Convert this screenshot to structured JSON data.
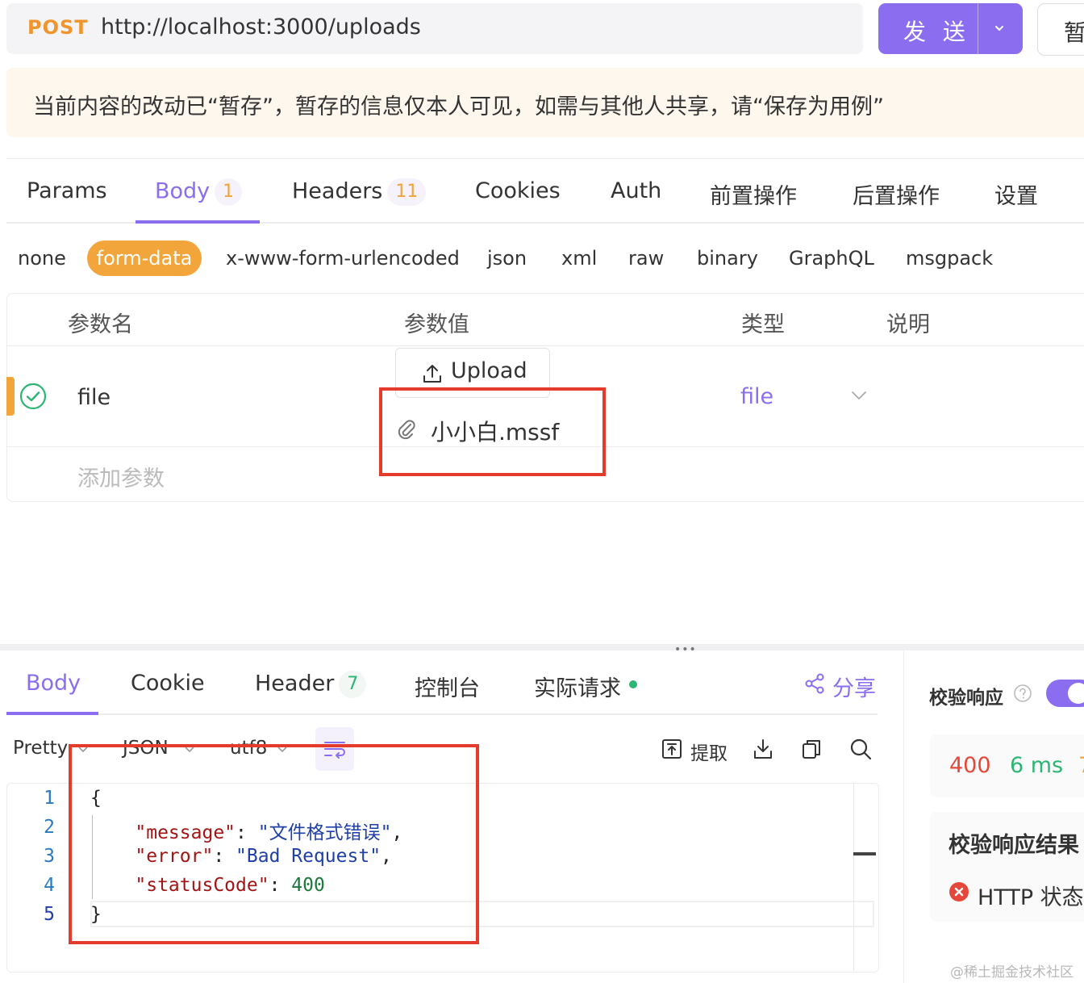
{
  "request": {
    "method": "POST",
    "url": "http://localhost:3000/uploads",
    "send_label": "发 送",
    "save_label": "暂"
  },
  "notice": "当前内容的改动已“暂存”，暂存的信息仅本人可见，如需与其他人共享，请“保存为用例”",
  "request_tabs": [
    {
      "label": "Params"
    },
    {
      "label": "Body",
      "badge": "1",
      "active": true
    },
    {
      "label": "Headers",
      "badge": "11"
    },
    {
      "label": "Cookies"
    },
    {
      "label": "Auth"
    },
    {
      "label": "前置操作"
    },
    {
      "label": "后置操作"
    },
    {
      "label": "设置"
    }
  ],
  "body_types": [
    "none",
    "form-data",
    "x-www-form-urlencoded",
    "json",
    "xml",
    "raw",
    "binary",
    "GraphQL",
    "msgpack"
  ],
  "body_type_selected": "form-data",
  "param_table": {
    "headers": [
      "参数名",
      "参数值",
      "类型",
      "说明"
    ],
    "rows": [
      {
        "enabled": true,
        "name": "file",
        "upload_label": "Upload",
        "file_name": "小小白.mssf",
        "type": "file"
      }
    ],
    "add_placeholder": "添加参数"
  },
  "response_tabs": [
    {
      "label": "Body",
      "active": true
    },
    {
      "label": "Cookie"
    },
    {
      "label": "Header",
      "badge": "7"
    },
    {
      "label": "控制台"
    },
    {
      "label": "实际请求",
      "dot": true
    }
  ],
  "share_label": "分享",
  "format": {
    "view": "Pretty",
    "lang": "JSON",
    "encoding": "utf8",
    "extract_label": "提取"
  },
  "code": {
    "line_numbers": [
      "1",
      "2",
      "3",
      "4",
      "5"
    ],
    "open_brace": "{",
    "close_brace": "}",
    "message_key": "\"message\"",
    "message_value": "\"文件格式错误\"",
    "error_key": "\"error\"",
    "error_value": "\"Bad Request\"",
    "status_key": "\"statusCode\"",
    "status_value": "400"
  },
  "verify": {
    "label": "校验响应",
    "enabled": true,
    "status": "400",
    "time": "6 ms",
    "time_tail": "7",
    "result_title": "校验响应结果",
    "result_item": "HTTP 状态"
  },
  "watermark": "@稀土掘金技术社区",
  "colors": {
    "accent": "#8b6ef0",
    "orange": "#f2a53b",
    "error": "#e5483a",
    "success": "#2bb673",
    "highlight_box": "#e53b2c"
  }
}
